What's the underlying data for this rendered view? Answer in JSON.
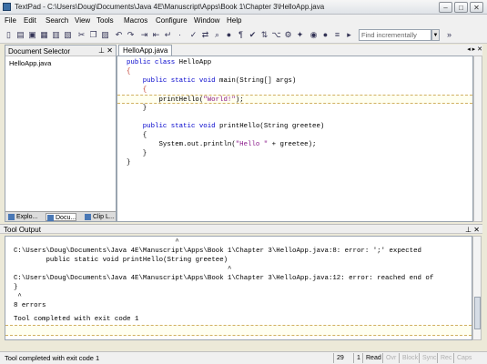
{
  "window": {
    "title": "TextPad - C:\\Users\\Doug\\Documents\\Java 4E\\Manuscript\\Apps\\Book 1\\Chapter 3\\HelloApp.java",
    "minimize": "–",
    "maximize": "□",
    "close": "✕"
  },
  "menu": [
    "File",
    "Edit",
    "Search",
    "View",
    "Tools",
    "Macros",
    "Configure",
    "Window",
    "Help"
  ],
  "toolbar": {
    "icons": [
      "new-file-icon",
      "open-folder-icon",
      "save-icon",
      "save-all-icon",
      "print-icon",
      "print-preview-icon",
      "cut-icon",
      "copy-icon",
      "paste-icon",
      "undo-icon",
      "redo-icon",
      "indent-icon",
      "outdent-icon",
      "word-wrap-icon",
      "visible-spaces-icon",
      "spell-check-icon",
      "compare-icon",
      "find-icon",
      "replace-icon",
      "web-icon",
      "paragraph-icon",
      "checkmark-icon",
      "sort-icon",
      "compile-icon",
      "run-icon",
      "record-macro-icon",
      "playback-macro-icon"
    ],
    "find_placeholder": "Find incrementally"
  },
  "doc_selector": {
    "title": "Document Selector",
    "items": [
      "HelloApp.java"
    ],
    "tabs": [
      "Explo...",
      "Docu...",
      "Clip L..."
    ]
  },
  "editor": {
    "tab": "HelloApp.java",
    "lines": [
      {
        "pre": "",
        "kw": "public class",
        "post": " HelloApp",
        "str": "",
        "tail": "",
        "gutter": ""
      },
      {
        "pre": "{",
        "kw": "",
        "post": "",
        "str": "",
        "tail": "",
        "gutter": ""
      },
      {
        "pre": "    ",
        "kw": "public static void",
        "post": " main(String[] args)",
        "str": "",
        "tail": "",
        "gutter": ""
      },
      {
        "pre": "    {",
        "kw": "",
        "post": "",
        "str": "",
        "tail": "",
        "gutter": ""
      },
      {
        "pre": "        printHello(",
        "kw": "",
        "post": "",
        "str": "\"World!\"",
        "tail": ");",
        "gutter": ""
      },
      {
        "pre": "    }",
        "kw": "",
        "post": "",
        "str": "",
        "tail": "",
        "gutter": ""
      },
      {
        "pre": "",
        "kw": "",
        "post": "",
        "str": "",
        "tail": "",
        "gutter": ""
      },
      {
        "pre": "    ",
        "kw": "public static void",
        "post": " printHello(String greetee)",
        "str": "",
        "tail": "",
        "gutter": ""
      },
      {
        "pre": "    {",
        "kw": "",
        "post": "",
        "str": "",
        "tail": "",
        "gutter": ""
      },
      {
        "pre": "        System.out.println(",
        "kw": "",
        "post": "",
        "str": "\"Hello \"",
        "tail": " + greetee);",
        "gutter": ""
      },
      {
        "pre": "    }",
        "kw": "",
        "post": "",
        "str": "",
        "tail": "",
        "gutter": ""
      },
      {
        "pre": "}",
        "kw": "",
        "post": "",
        "str": "",
        "tail": "",
        "gutter": ""
      }
    ]
  },
  "tool_output": {
    "title": "Tool Output",
    "lines": [
      "                                        ^",
      "C:\\Users\\Doug\\Documents\\Java 4E\\Manuscript\\Apps\\Book 1\\Chapter 3\\HelloApp.java:8: error: ';' expected",
      "        public static void printHello(String greetee)",
      "                                                     ^",
      "C:\\Users\\Doug\\Documents\\Java 4E\\Manuscript\\Apps\\Book 1\\Chapter 3\\HelloApp.java:12: error: reached end of",
      "}",
      " ^",
      "8 errors",
      "",
      "Tool completed with exit code 1"
    ]
  },
  "status": {
    "message": "Tool completed with exit code 1",
    "line": "29",
    "col": "1",
    "mode": "Read",
    "flags": [
      "Ovr",
      "Block",
      "Sync",
      "Rec",
      "Caps"
    ]
  },
  "colors": {
    "keyword": "#0000cc",
    "string": "#8b1a8b",
    "highlight_line": "#fffff0"
  }
}
